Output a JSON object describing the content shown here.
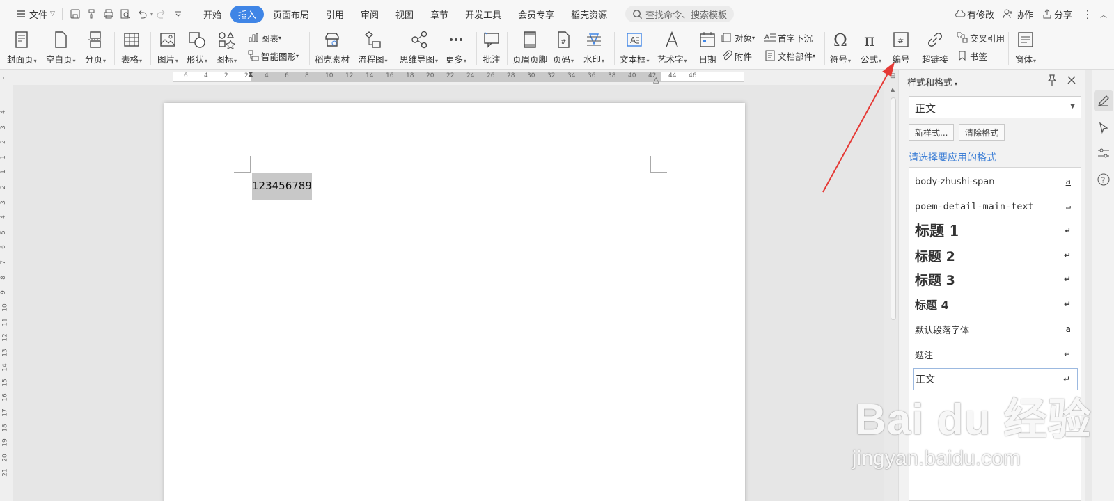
{
  "menubar": {
    "file": "文件",
    "tabs": [
      "开始",
      "插入",
      "页面布局",
      "引用",
      "审阅",
      "视图",
      "章节",
      "开发工具",
      "会员专享",
      "稻壳资源"
    ],
    "active_tab": "插入",
    "search_placeholder": "查找命令、搜索模板",
    "right": {
      "modified": "有修改",
      "collab": "协作",
      "share": "分享"
    }
  },
  "ribbon": {
    "cover": "封面页",
    "blank": "空白页",
    "break": "分页",
    "table": "表格",
    "picture": "图片",
    "shape": "形状",
    "icon": "图标",
    "chart": "图表",
    "smartart": "智能图形",
    "docer": "稻壳素材",
    "flow": "流程图",
    "mind": "思维导图",
    "more": "更多",
    "comment": "批注",
    "header_footer": "页眉页脚",
    "page_num": "页码",
    "watermark": "水印",
    "textbox": "文本框",
    "wordart": "艺术字",
    "date": "日期",
    "object": "对象",
    "attachment": "附件",
    "dropcap": "首字下沉",
    "docpart": "文档部件",
    "symbol": "符号",
    "formula": "公式",
    "numbering": "编号",
    "hyperlink": "超链接",
    "crossref": "交叉引用",
    "bookmark": "书签",
    "form": "窗体"
  },
  "ruler": {
    "h_ticks": [
      "6",
      "4",
      "2",
      "2",
      "4",
      "6",
      "8",
      "10",
      "12",
      "14",
      "16",
      "18",
      "20",
      "22",
      "24",
      "26",
      "28",
      "30",
      "32",
      "34",
      "36",
      "38",
      "40",
      "42",
      "44",
      "46"
    ],
    "v_ticks": [
      "4",
      "3",
      "2",
      "1",
      "1",
      "2",
      "3",
      "4",
      "5",
      "6",
      "7",
      "8",
      "9",
      "10",
      "11",
      "12",
      "13",
      "14",
      "15",
      "16",
      "17",
      "18",
      "19",
      "20",
      "21"
    ]
  },
  "document": {
    "selected_text": "123456789"
  },
  "pane": {
    "title": "样式和格式",
    "current_style": "正文",
    "new_style": "新样式...",
    "clear_format": "清除格式",
    "hint": "请选择要应用的格式",
    "styles": [
      {
        "name": "body-zhushi-span",
        "mark": "a"
      },
      {
        "name": "poem-detail-main-text",
        "mark": "↵"
      },
      {
        "name": "标题 1",
        "mark": "↵"
      },
      {
        "name": "标题 2",
        "mark": "↵"
      },
      {
        "name": "标题 3",
        "mark": "↵"
      },
      {
        "name": "标题 4",
        "mark": "↵"
      },
      {
        "name": "默认段落字体",
        "mark": "a"
      },
      {
        "name": "题注",
        "mark": "↵"
      },
      {
        "name": "正文",
        "mark": "↵"
      }
    ]
  },
  "watermark": {
    "brand": "Bai du 经验",
    "url": "jingyan.baidu.com"
  },
  "colors": {
    "accent": "#3f85e6",
    "hint": "#3d7fd6",
    "arrow": "#e53935"
  }
}
